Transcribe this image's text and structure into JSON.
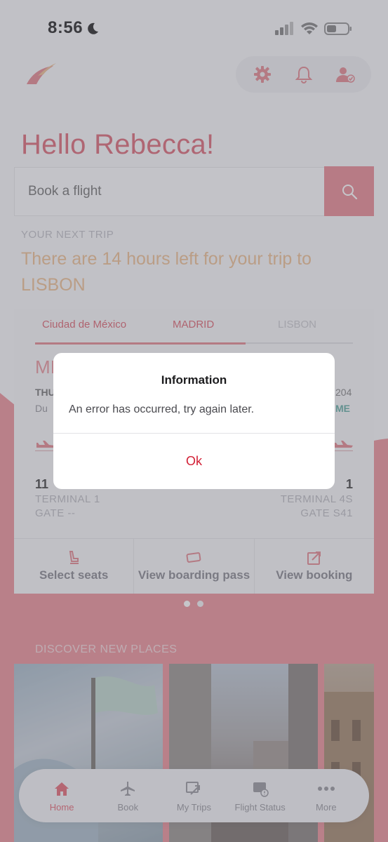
{
  "status_bar": {
    "time": "8:56"
  },
  "header": {
    "greeting": "Hello Rebecca!"
  },
  "search": {
    "placeholder": "Book a flight"
  },
  "next_trip": {
    "kicker": "YOUR NEXT TRIP",
    "title": "There are 14 hours left for your trip to LISBON",
    "route": [
      "Ciudad de México",
      "MADRID",
      "LISBON"
    ],
    "card": {
      "big_code": "MI",
      "day_left": "THU",
      "dur_left": "Du",
      "right_top": "204",
      "right_status": "ME",
      "time_left": "11",
      "time_right": "1",
      "terminal_left": "TERMINAL 1",
      "gate_left": "GATE --",
      "terminal_right": "TERMINAL 4S",
      "gate_right": "GATE S41"
    },
    "actions": {
      "select_seats": "Select seats",
      "boarding_pass": "View boarding pass",
      "view_booking": "View booking"
    }
  },
  "discover": {
    "title": "DISCOVER NEW PLACES"
  },
  "tab_bar": {
    "home": "Home",
    "book": "Book",
    "my_trips": "My Trips",
    "flight_status": "Flight Status",
    "more": "More"
  },
  "dialog": {
    "title": "Information",
    "message": "An error has occurred, try again later.",
    "ok": "Ok"
  },
  "colors": {
    "brand_red": "#d21f35",
    "accent_pink": "#e57f88",
    "gold": "#eab989"
  },
  "carousel": {
    "pages": 2,
    "active_page": 1
  }
}
